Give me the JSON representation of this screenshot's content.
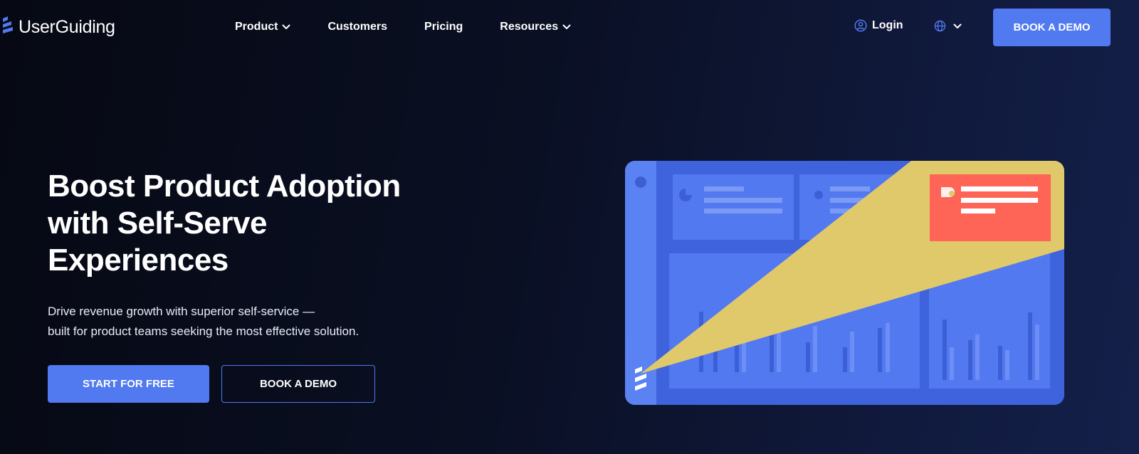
{
  "brand": {
    "name": "UserGuiding",
    "logo_icon": "stacked-bars-logo",
    "accent_color": "#5179f0"
  },
  "nav": {
    "items": [
      {
        "label": "Product",
        "has_dropdown": true
      },
      {
        "label": "Customers",
        "has_dropdown": false
      },
      {
        "label": "Pricing",
        "has_dropdown": false
      },
      {
        "label": "Resources",
        "has_dropdown": true
      }
    ],
    "login_label": "Login",
    "login_icon": "user-circle-icon",
    "language_icon": "globe-icon",
    "cta_label": "BOOK A DEMO"
  },
  "hero": {
    "title": "Boost Product Adoption with Self-Serve Experiences",
    "subtitle_lines": [
      "Drive revenue growth with superior self-service —",
      "built for product teams seeking the most effective solution."
    ],
    "primary_button": "START FOR FREE",
    "secondary_button": "BOOK A DEMO"
  },
  "illustration": {
    "panel_color": "#5074f0",
    "spotlight_color": "#e0c96a",
    "tooltip_color": "#fe6556"
  }
}
